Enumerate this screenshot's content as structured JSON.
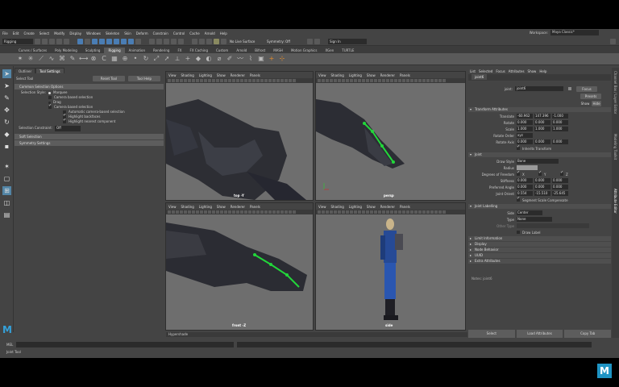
{
  "menubar": [
    "File",
    "Edit",
    "Create",
    "Select",
    "Modify",
    "Display",
    "Windows",
    "Skeleton",
    "Skin",
    "Deform",
    "Constrain",
    "Control",
    "Cache",
    "Arnold",
    "Help"
  ],
  "workspace": {
    "label": "Workspace:",
    "value": "Maya Classic*"
  },
  "status": {
    "menuset": "Rigging",
    "symmetry": "Symmetry: Off",
    "live": "No Live Surface",
    "signin": "Sign In"
  },
  "shelf_tabs": [
    "Curves / Surfaces",
    "Poly Modeling",
    "Sculpting",
    "Rigging",
    "Animation",
    "Rendering",
    "FX",
    "FX Caching",
    "Custom",
    "Arnold",
    "Bifrost",
    "MASH",
    "Motion Graphics",
    "XGen",
    "TURTLE"
  ],
  "shelf_active": "Rigging",
  "toolset": {
    "tabs": [
      "Outliner",
      "Tool Settings"
    ],
    "title": "Select Tool",
    "reset": "Reset Tool",
    "help": "Tool Help",
    "section_common": "Common Selection Options",
    "selection_style_label": "Selection Style:",
    "marquee": "Marquee",
    "camera_based": "Camera based selection",
    "drag": "Drag",
    "camera_based_sel": "Camera based selection",
    "auto_camera": "Automatic camera-based selection",
    "highlight_backfaces": "Highlight backfaces",
    "highlight_nearest": "Highlight nearest component",
    "constraint_label": "Selection Constraint:",
    "constraint_value": "Off",
    "soft_selection": "Soft Selection",
    "symmetry_settings": "Symmetry Settings"
  },
  "panel_menu": [
    "View",
    "Shading",
    "Lighting",
    "Show",
    "Renderer",
    "Panels"
  ],
  "viewports": {
    "tl": "top -Y",
    "tr": "persp",
    "bl": "front -Z",
    "br": "side"
  },
  "hypershade": "Hypershade",
  "attr_editor": {
    "menu": [
      "List",
      "Selected",
      "Focus",
      "Attributes",
      "Show",
      "Help"
    ],
    "tab": "joint6",
    "name_label": "joint:",
    "name_value": "joint6",
    "focus": "Focus",
    "presets": "Presets",
    "show": "Show",
    "hide": "Hide",
    "transform_section": "Transform Attributes",
    "translate_label": "Translate",
    "translate": [
      "-60.962",
      "147.396",
      "-1.000"
    ],
    "rotate_label": "Rotate",
    "rotate": [
      "0.000",
      "0.000",
      "0.000"
    ],
    "scale_label": "Scale",
    "scale": [
      "1.000",
      "1.000",
      "1.000"
    ],
    "rotate_order_label": "Rotate Order",
    "rotate_order": "xyz",
    "rotate_axis_label": "Rotate Axis",
    "rotate_axis": [
      "0.000",
      "0.000",
      "0.000"
    ],
    "inherits": "Inherits Transform",
    "joint_section": "Joint",
    "draw_style_label": "Draw Style",
    "draw_style": "Bone",
    "radius_label": "Radius",
    "dof_label": "Degrees of Freedom",
    "dof": [
      "X",
      "Y",
      "Z"
    ],
    "stiffness_label": "Stiffness",
    "stiffness": [
      "0.000",
      "0.000",
      "0.000"
    ],
    "preferred_label": "Preferred Angle",
    "preferred": [
      "0.000",
      "0.000",
      "0.000"
    ],
    "orient_label": "Joint Orient",
    "orient": [
      "0.554",
      "-15.510",
      "-25.645"
    ],
    "segment": "Segment Scale Compensate",
    "labelling_section": "Joint Labelling",
    "side_label": "Side",
    "side": "Center",
    "type_label": "Type",
    "type": "None",
    "other_label": "Other Type",
    "draw_label": "Draw Label",
    "collapsed": [
      "Limit Information",
      "Display",
      "Node Behavior",
      "UUID",
      "Extra Attributes"
    ],
    "notes": "Notes: joint6",
    "bottom": [
      "Select",
      "Load Attributes",
      "Copy Tab"
    ]
  },
  "side_tabs": [
    "Channel Box / Layer Editor",
    "Modeling Toolkit",
    "Attribute Editor"
  ],
  "cmdline": {
    "mel": "MEL"
  },
  "help": "Joint Tool",
  "colors": {
    "accent": "#5285a6",
    "bone": "#22d63a"
  }
}
